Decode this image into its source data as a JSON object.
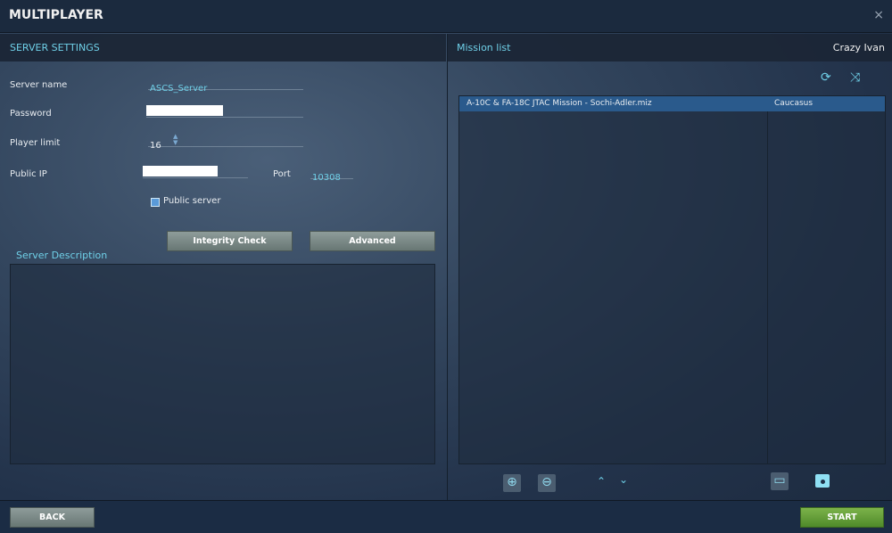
{
  "window": {
    "title": "MULTIPLAYER",
    "close_icon": "×"
  },
  "server_settings": {
    "header": "SERVER SETTINGS",
    "server_name_label": "Server name",
    "server_name": "ASCS_Server",
    "password_label": "Password",
    "player_limit_label": "Player limit",
    "player_limit": "16",
    "public_ip_label": "Public IP",
    "port_label": "Port",
    "port": "10308",
    "public_server_label": "Public server",
    "public_server_checked": true,
    "integrity_check": "Integrity Check",
    "advanced": "Advanced",
    "description_label": "Server Description"
  },
  "mission_list": {
    "header": "Mission list",
    "user": "Crazy Ivan",
    "rows": [
      {
        "mission": "A-10C & FA-18C JTAC Mission - Sochi-Adler.miz",
        "map": "Caucasus"
      }
    ]
  },
  "footer": {
    "back": "BACK",
    "start": "START"
  },
  "colors": {
    "accent": "#6fd0e8",
    "selected_row": "#2a5a8c",
    "start": "#5e9a35"
  }
}
